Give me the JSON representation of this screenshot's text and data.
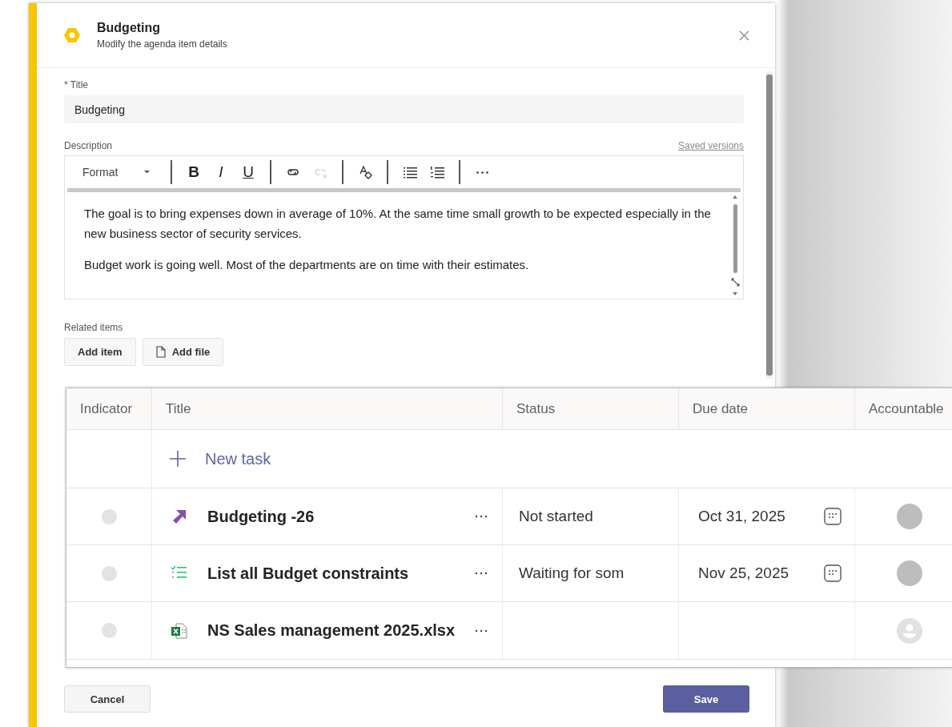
{
  "dialog": {
    "title": "Budgeting",
    "subtitle": "Modify the agenda item details"
  },
  "form": {
    "title_label": "* Title",
    "title_value": "Budgeting",
    "description_label": "Description",
    "saved_versions_link": "Saved versions",
    "toolbar": [
      {
        "kind": "dropdown",
        "label": "Format"
      },
      {
        "kind": "sep"
      },
      {
        "kind": "bold",
        "label": "B"
      },
      {
        "kind": "italic",
        "label": "I"
      },
      {
        "kind": "underline",
        "label": "U"
      },
      {
        "kind": "sep"
      },
      {
        "kind": "link",
        "disabled": false
      },
      {
        "kind": "unlink",
        "disabled": true
      },
      {
        "kind": "sep"
      },
      {
        "kind": "clear-format",
        "disabled": false
      },
      {
        "kind": "sep"
      },
      {
        "kind": "bullets",
        "disabled": false
      },
      {
        "kind": "numbering",
        "disabled": false
      },
      {
        "kind": "sep"
      },
      {
        "kind": "more",
        "disabled": false
      }
    ],
    "description": [
      "The goal is to bring expenses down in average of 10%. At the same time small growth to be expected especially in the new business sector of security services.",
      "Budget work is going well. Most of the departments are on time with their estimates."
    ],
    "related_label": "Related items",
    "related_buttons": [
      {
        "kind": "plain",
        "label": "Add item"
      },
      {
        "kind": "file",
        "label": "Add file"
      }
    ]
  },
  "table": {
    "columns": [
      "Indicator",
      "Title",
      "Status",
      "Due date",
      "Accountable"
    ],
    "new_task": "New task",
    "rows": [
      {
        "kind": "task",
        "title": "Budgeting -26",
        "status": "Not started",
        "due_date": "Oct 31, 2025",
        "accountable": {
          "kind": "photo"
        }
      },
      {
        "kind": "checklist",
        "title": "List all Budget constraints",
        "status": "Waiting for som",
        "due_date": "Nov 25, 2025",
        "accountable": {
          "kind": "photo"
        }
      },
      {
        "kind": "excel",
        "title": "NS Sales management 2025.xlsx",
        "accountable": {
          "kind": "placeholder"
        }
      }
    ]
  },
  "footer": [
    {
      "kind": "secondary",
      "label": "Cancel"
    },
    {
      "kind": "primary",
      "label": "Save"
    }
  ]
}
